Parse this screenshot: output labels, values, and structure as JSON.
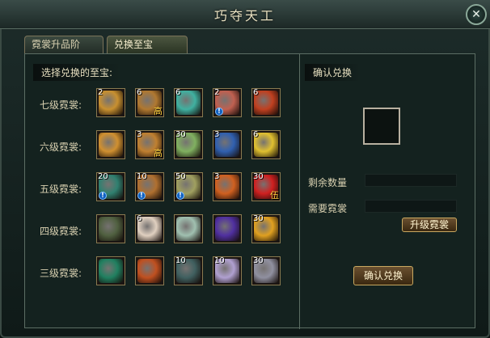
{
  "title": "巧夺天工",
  "close_glyph": "✕",
  "tabs": [
    {
      "label": "霓裳升品阶"
    },
    {
      "label": "兑换至宝"
    }
  ],
  "left": {
    "heading": "选择兑换的至宝:",
    "rows": [
      {
        "label": "七级霓裳:"
      },
      {
        "label": "六级霓裳:"
      },
      {
        "label": "五级霓裳:"
      },
      {
        "label": "四级霓裳:"
      },
      {
        "label": "三级霓裳:"
      }
    ],
    "items": [
      [
        {
          "count": "2",
          "icon": "scroll-icon",
          "color": "#c89030",
          "mark": false,
          "tag": ""
        },
        {
          "count": "6",
          "icon": "clock-scroll-icon",
          "color": "#b07830",
          "mark": false,
          "tag": "高"
        },
        {
          "count": "6",
          "icon": "vase-icon",
          "color": "#40b0a0",
          "mark": false,
          "tag": ""
        },
        {
          "count": "2",
          "icon": "treasure-box-icon",
          "color": "#c06050",
          "mark": true,
          "tag": ""
        },
        {
          "count": "6",
          "icon": "red-book-icon",
          "color": "#c04020",
          "mark": false,
          "tag": ""
        }
      ],
      [
        {
          "count": "",
          "icon": "gold-plate-icon",
          "color": "#d09030",
          "mark": false,
          "tag": ""
        },
        {
          "count": "3",
          "icon": "scroll-icon",
          "color": "#c08030",
          "mark": false,
          "tag": "高"
        },
        {
          "count": "30",
          "icon": "lotus-icon",
          "color": "#80b060",
          "mark": false,
          "tag": ""
        },
        {
          "count": "3",
          "icon": "blue-scroll-icon",
          "color": "#3060b0",
          "mark": false,
          "tag": ""
        },
        {
          "count": "6",
          "icon": "gold-coin-icon",
          "color": "#e0c030",
          "mark": false,
          "tag": ""
        }
      ],
      [
        {
          "count": "20",
          "icon": "jade-stone-icon",
          "color": "#308070",
          "mark": true,
          "tag": ""
        },
        {
          "count": "10",
          "icon": "scroll-icon",
          "color": "#b07030",
          "mark": true,
          "tag": ""
        },
        {
          "count": "50",
          "icon": "jade-coin-icon",
          "color": "#a0a060",
          "mark": true,
          "tag": ""
        },
        {
          "count": "3",
          "icon": "flame-scroll-icon",
          "color": "#d06020",
          "mark": false,
          "tag": ""
        },
        {
          "count": "30",
          "icon": "red-lantern-icon",
          "color": "#d02020",
          "mark": false,
          "tag": "伍"
        }
      ],
      [
        {
          "count": "",
          "icon": "tortoise-icon",
          "color": "#506040",
          "mark": false,
          "tag": ""
        },
        {
          "count": "6",
          "icon": "swirl-shell-icon",
          "color": "#e0d0c0",
          "mark": false,
          "tag": ""
        },
        {
          "count": "",
          "icon": "porcelain-vase-icon",
          "color": "#a0c0b0",
          "mark": false,
          "tag": ""
        },
        {
          "count": "",
          "icon": "purple-chest-icon",
          "color": "#5030a0",
          "mark": false,
          "tag": ""
        },
        {
          "count": "30",
          "icon": "golden-orb-icon",
          "color": "#e0a020",
          "mark": false,
          "tag": ""
        }
      ],
      [
        {
          "count": "",
          "icon": "globe-icon",
          "color": "#208060",
          "mark": false,
          "tag": ""
        },
        {
          "count": "",
          "icon": "fire-spiral-icon",
          "color": "#c05020",
          "mark": false,
          "tag": ""
        },
        {
          "count": "10",
          "icon": "statue-icon",
          "color": "#406060",
          "mark": false,
          "tag": ""
        },
        {
          "count": "10",
          "icon": "crystal-icon",
          "color": "#b0a0d0",
          "mark": false,
          "tag": ""
        },
        {
          "count": "30",
          "icon": "silver-pot-icon",
          "color": "#9090a0",
          "mark": false,
          "tag": ""
        }
      ]
    ]
  },
  "right": {
    "heading": "确认兑换",
    "remaining_label": "剩余数量",
    "required_label": "需要霓裳",
    "upgrade_button": "升级霓裳",
    "confirm_button": "确认兑换"
  }
}
